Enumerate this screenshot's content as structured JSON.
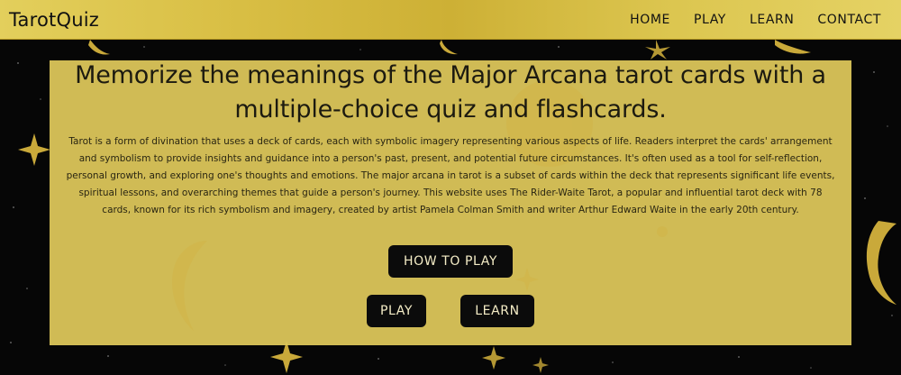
{
  "nav": {
    "logo": "TarotQuiz",
    "links": [
      "HOME",
      "PLAY",
      "LEARN",
      "CONTACT"
    ]
  },
  "hero": {
    "title": "Memorize the meanings of the Major Arcana tarot cards with a multiple-choice quiz and flashcards.",
    "description": "Tarot is a form of divination that uses a deck of cards, each with symbolic imagery representing various aspects of life. Readers interpret the cards' arrangement and symbolism to provide insights and guidance into a person's past, present, and potential future circumstances. It's often used as a tool for self-reflection, personal growth, and exploring one's thoughts and emotions. The major arcana in tarot is a subset of cards within the deck that represents significant life events, spiritual lessons, and overarching themes that guide a person's journey. This website uses The Rider-Waite Tarot, a popular and influential tarot deck with 78 cards, known for its rich symbolism and imagery, created by artist Pamela Colman Smith and writer Arthur Edward Waite in the early 20th century."
  },
  "buttons": {
    "how_to_play": "HOW TO PLAY",
    "play": "PLAY",
    "learn": "LEARN"
  },
  "colors": {
    "gold": "#d9c04a",
    "panel": "#ddc75a",
    "button_bg": "#0b0b0b",
    "background": "#060606"
  }
}
